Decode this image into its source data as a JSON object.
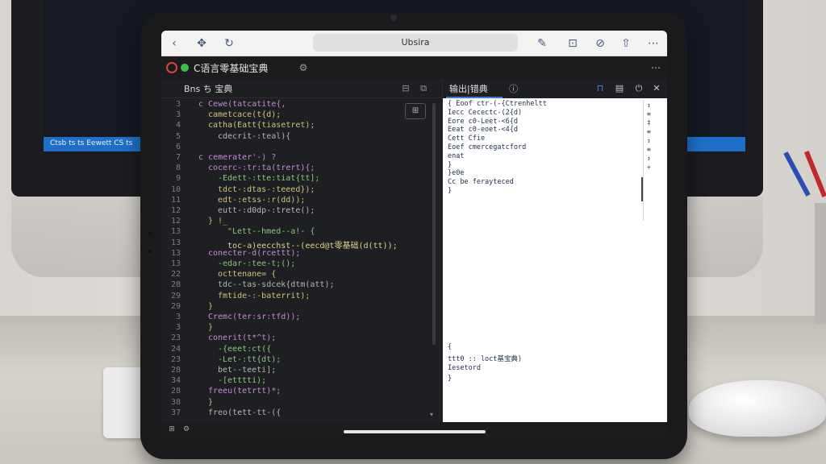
{
  "browser": {
    "url_text": "Ubsira",
    "icons": [
      "chevron-left-icon",
      "move-icon",
      "refresh-icon",
      "edit-icon",
      "bookmark-icon",
      "compass-icon",
      "share-icon",
      "more-icon"
    ]
  },
  "app": {
    "title": "C语言零基础宝典",
    "menu_glyph": "⋯"
  },
  "editor": {
    "tab_label": "Bns ち   宝典",
    "float_button": "⊞",
    "lines": [
      {
        "n": "3",
        "t": "c Cewe(tatcatite{,",
        "c": "#c58ad8",
        "i": 0
      },
      {
        "n": "3",
        "t": "cametcace(t{d);",
        "c": "#d0c27a",
        "i": 1
      },
      {
        "n": "4",
        "t": "catha(Eatt{tiasetret);",
        "c": "#d0c27a",
        "i": 1
      },
      {
        "n": "5",
        "t": "cdecrit-:teal){",
        "c": "#b6b6b6",
        "i": 2
      },
      {
        "n": "6",
        "t": "",
        "c": "#b6b6b6",
        "i": 0
      },
      {
        "n": "7",
        "t": "c cemerater'-)   ?",
        "c": "#c58ad8",
        "i": 0
      },
      {
        "n": "8",
        "t": "cocerc-:tr:ta(trert){;",
        "c": "#c58ad8",
        "i": 1
      },
      {
        "n": "9",
        "t": "-Edett-:tte:tiat{tt];",
        "c": "#86c77c",
        "i": 2
      },
      {
        "n": "10",
        "t": "tdct-:dtas-:teeed});",
        "c": "#d0c27a",
        "i": 2
      },
      {
        "n": "11",
        "t": "edt-:etss-:r(dd));",
        "c": "#d0c27a",
        "i": 2
      },
      {
        "n": "12",
        "t": "eutt-:d0dp-:trete();",
        "c": "#b6b6b6",
        "i": 2
      },
      {
        "n": "12",
        "t": "} !_",
        "c": "#d0c27a",
        "i": 1
      },
      {
        "n": "13",
        "t": "\"Lett--hmed--a!- {",
        "c": "#86c77c",
        "i": 3
      },
      {
        "n": "13",
        "t": "toc-a)eecchst--(eecd@t零基础(d(tt));",
        "c": "#e0d48a",
        "i": 3
      },
      {
        "n": "13",
        "t": "conecter-d(rcettt);",
        "c": "#c58ad8",
        "i": 1
      },
      {
        "n": "13",
        "t": "-edar-:tee-t;();",
        "c": "#86c77c",
        "i": 2
      },
      {
        "n": "22",
        "t": "octtenane=  {",
        "c": "#d0c27a",
        "i": 2
      },
      {
        "n": "28",
        "t": "tdc--tas-sdcek{dtm(att);",
        "c": "#b6b6b6",
        "i": 2
      },
      {
        "n": "29",
        "t": "fmtide-:-baterrit);",
        "c": "#d0c27a",
        "i": 2
      },
      {
        "n": "29",
        "t": "}",
        "c": "#d0c27a",
        "i": 1
      },
      {
        "n": "3",
        "t": "Cremc(ter:sr:tfd));",
        "c": "#c58ad8",
        "i": 1
      },
      {
        "n": "3",
        "t": "}",
        "c": "#d0c27a",
        "i": 1
      },
      {
        "n": "23",
        "t": "conerit(t*^t);",
        "c": "#c58ad8",
        "i": 1
      },
      {
        "n": "24",
        "t": "-{eeet:ct({",
        "c": "#86c77c",
        "i": 2
      },
      {
        "n": "23",
        "t": "-Let-:tt{dt);",
        "c": "#86c77c",
        "i": 2
      },
      {
        "n": "28",
        "t": "bet--teeti];",
        "c": "#b6b6b6",
        "i": 2
      },
      {
        "n": "34",
        "t": "-[etttti);",
        "c": "#86c77c",
        "i": 2
      },
      {
        "n": "28",
        "t": "freeu(tetrtt)*;",
        "c": "#c58ad8",
        "i": 1
      },
      {
        "n": "38",
        "t": "}",
        "c": "#d0c27a",
        "i": 1
      },
      {
        "n": "37",
        "t": "freo(tett-tt-({",
        "c": "#b6b6b6",
        "i": 1
      }
    ]
  },
  "output": {
    "tab_label": "输出|错典",
    "tab_close": "ⓘ",
    "lines": [
      "{   Eoof  ctr-(-{Ctrenheltt",
      "     Iecc  Cecectc-(2{d)",
      "     Eore  c0-Leet-<6{d",
      "     Eeat  c0-eoet-<4{d",
      "     Cett  Cfie",
      "     Eoef  cmercegatcford",
      "     enat",
      "       }",
      "     }e0e",
      "       Cc  be ferayteced",
      "}"
    ],
    "lines2": [
      "{",
      "    ttt0  :: loct基宝典)",
      "   Iesetord",
      "}"
    ],
    "side_items": [
      "↕",
      "≡",
      "‡",
      "≡",
      "↕",
      "≡",
      "↕",
      "+"
    ]
  },
  "monitor": {
    "status_text": "Ctsb  ts  ts  Eewett  CS    ts"
  }
}
